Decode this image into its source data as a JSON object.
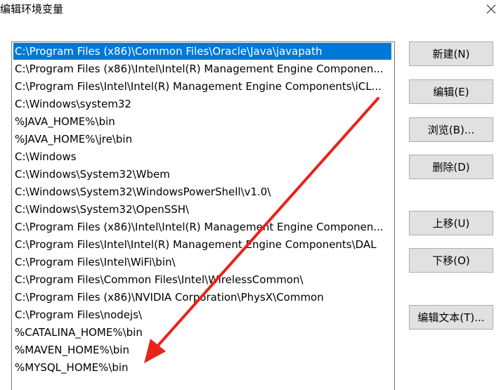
{
  "window": {
    "title": "编辑环境变量",
    "close_icon": "close-icon"
  },
  "path_list": [
    "C:\\Program Files (x86)\\Common Files\\Oracle\\Java\\javapath",
    "C:\\Program Files (x86)\\Intel\\Intel(R) Management Engine Componen...",
    "C:\\Program Files\\Intel\\Intel(R) Management Engine Components\\iCL...",
    "C:\\Windows\\system32",
    "%JAVA_HOME%\\bin",
    "%JAVA_HOME%\\jre\\bin",
    "C:\\Windows",
    "C:\\Windows\\System32\\Wbem",
    "C:\\Windows\\System32\\WindowsPowerShell\\v1.0\\",
    "C:\\Windows\\System32\\OpenSSH\\",
    "C:\\Program Files (x86)\\Intel\\Intel(R) Management Engine Componen...",
    "C:\\Program Files\\Intel\\Intel(R) Management Engine Components\\DAL",
    "C:\\Program Files\\Intel\\WiFi\\bin\\",
    "C:\\Program Files\\Common Files\\Intel\\WirelessCommon\\",
    "C:\\Program Files (x86)\\NVIDIA Corporation\\PhysX\\Common",
    "C:\\Program Files\\nodejs\\",
    "%CATALINA_HOME%\\bin",
    "%MAVEN_HOME%\\bin",
    "%MYSQL_HOME%\\bin"
  ],
  "selected_index": 0,
  "buttons": {
    "new": "新建(N)",
    "edit": "编辑(E)",
    "browse": "浏览(B)...",
    "delete": "删除(D)",
    "move_up": "上移(U)",
    "move_down": "下移(O)",
    "edit_text": "编辑文本(T)..."
  },
  "colors": {
    "selection": "#0078d7",
    "arrow": "#e8231a"
  }
}
